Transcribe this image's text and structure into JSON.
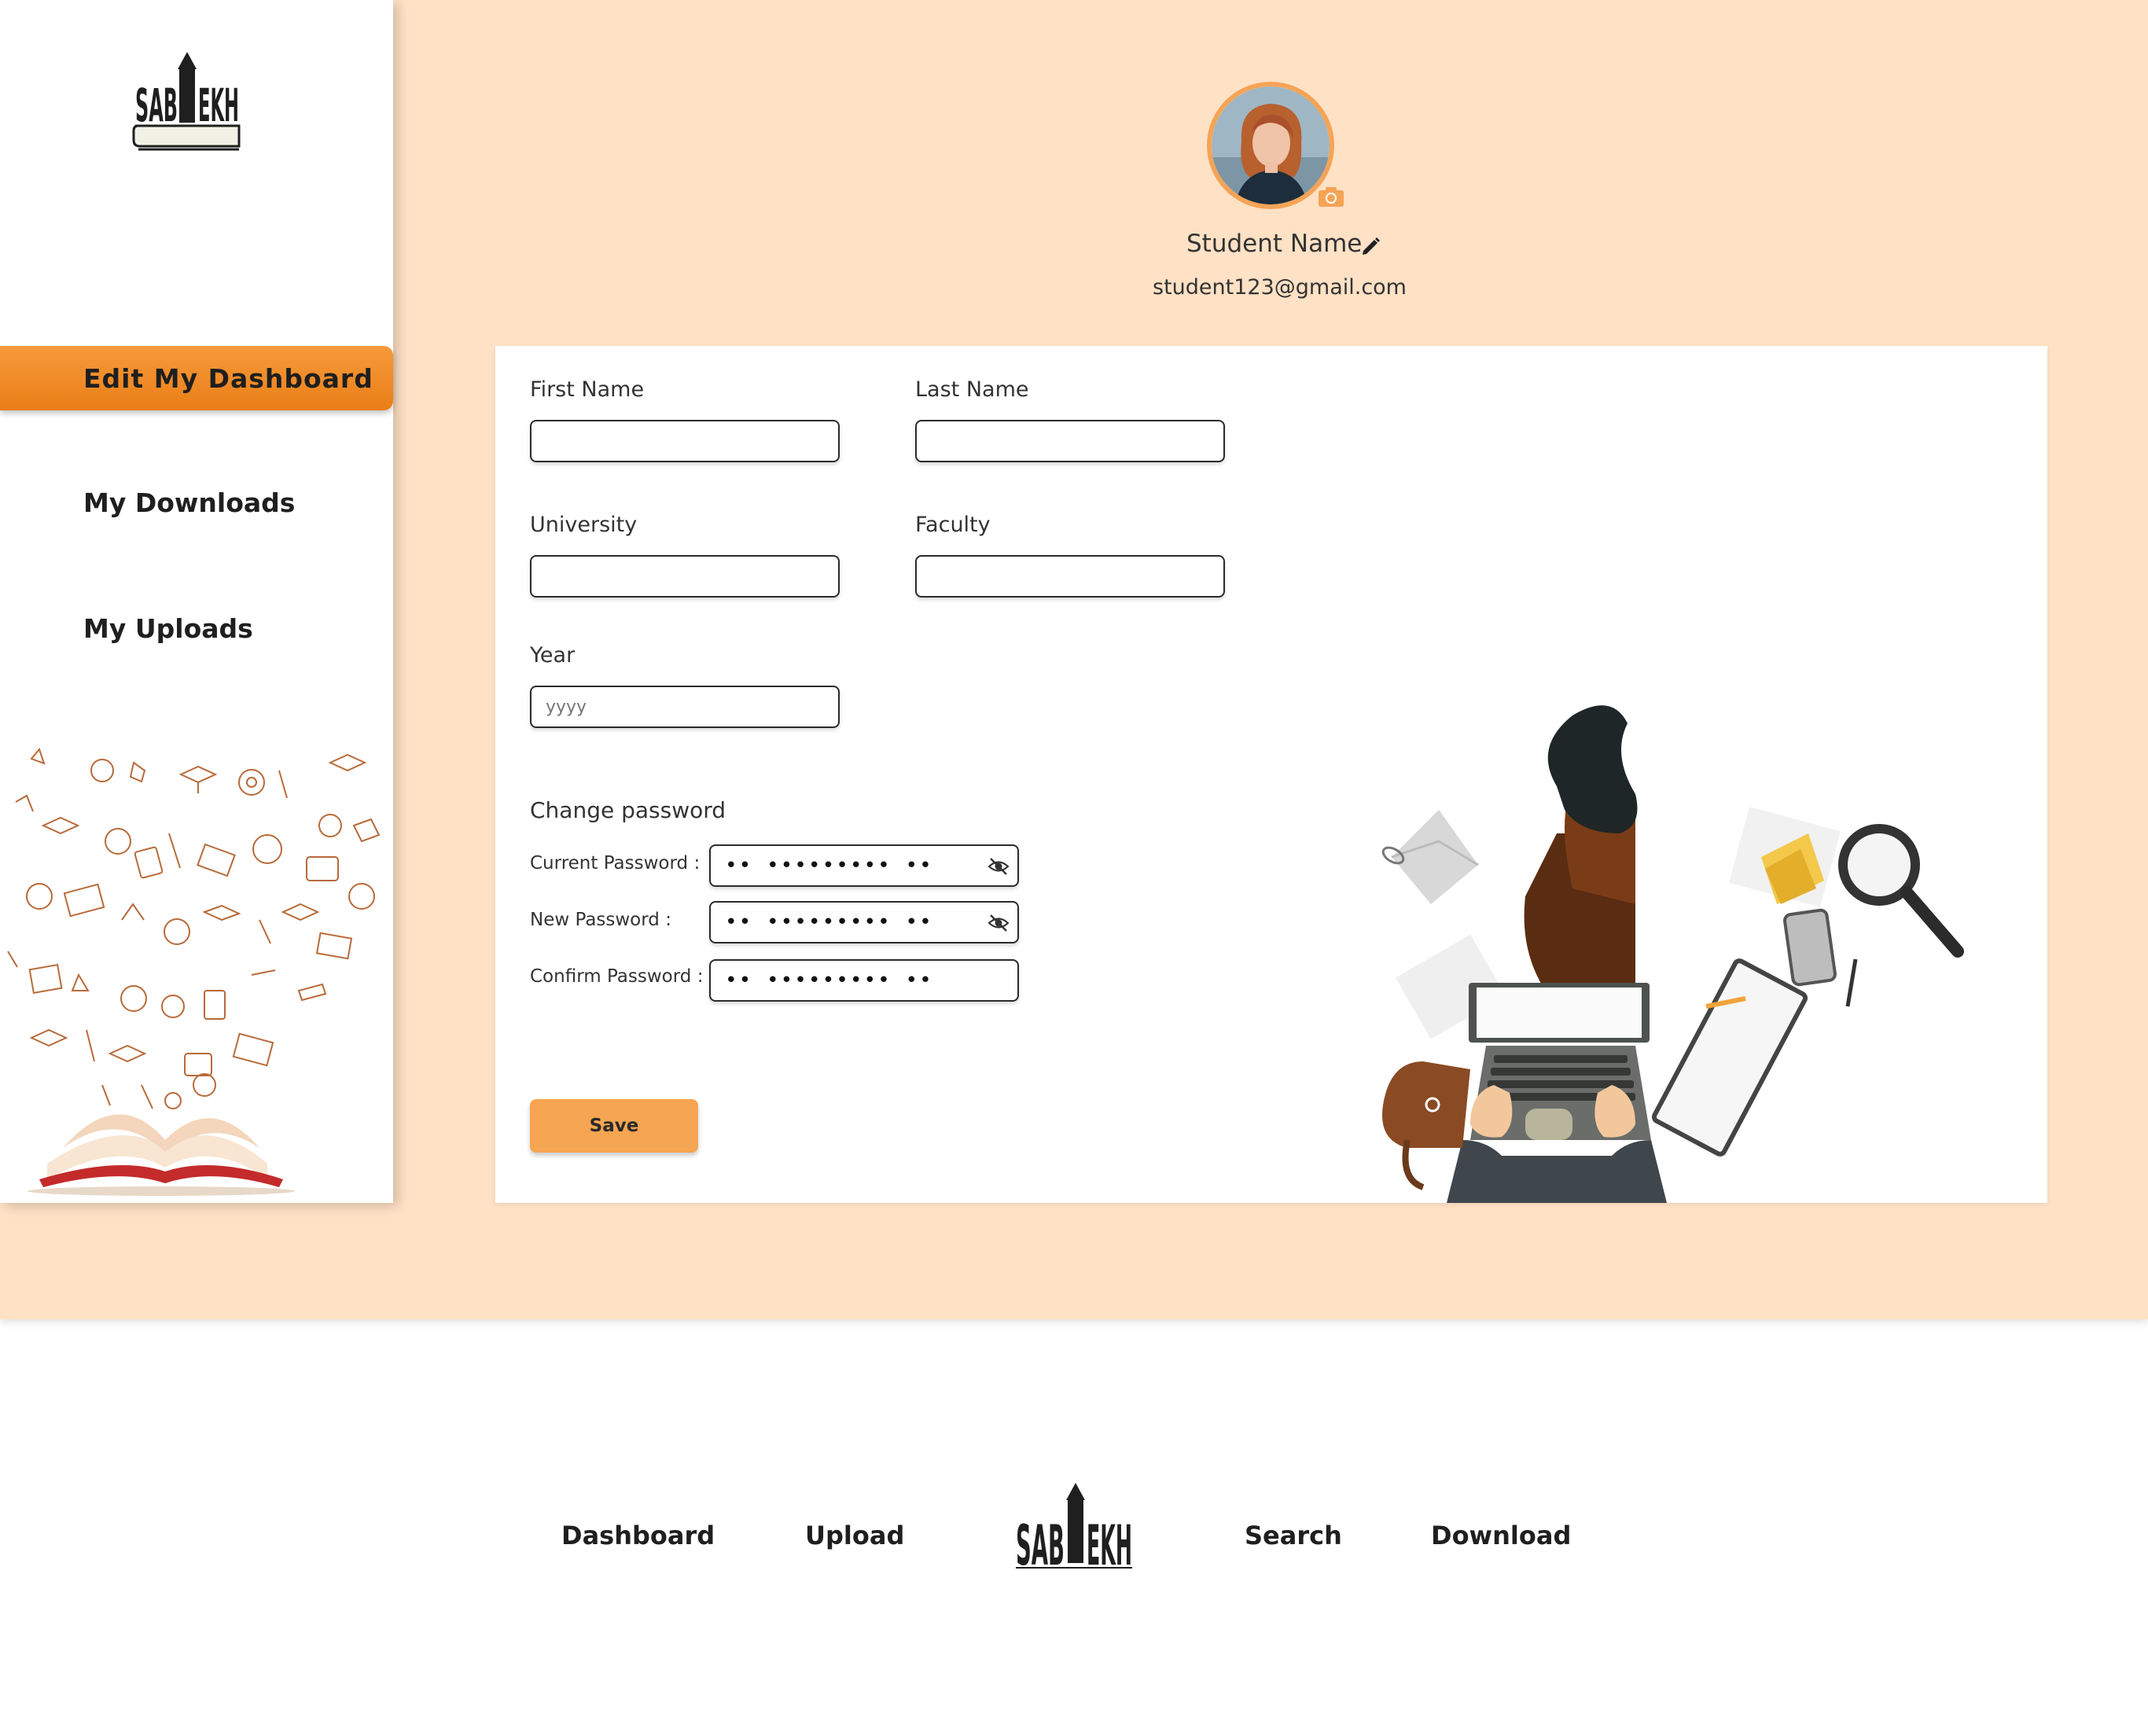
{
  "brand": {
    "logo_text": "SABLEKH",
    "accent": "#f5a455",
    "accent_dark": "#ea7e16",
    "background": "#ffe1c5"
  },
  "sidebar": {
    "items": [
      {
        "label": "Edit My Dashboard",
        "active": true
      },
      {
        "label": "My Downloads",
        "active": false
      },
      {
        "label": "My Uploads",
        "active": false
      }
    ]
  },
  "profile": {
    "name": "Student Name",
    "email": "student123@gmail.com",
    "icons": [
      "camera-icon",
      "pencil-icon"
    ]
  },
  "form": {
    "first_name": {
      "label": "First Name",
      "value": ""
    },
    "last_name": {
      "label": "Last Name",
      "value": ""
    },
    "university": {
      "label": "University",
      "value": ""
    },
    "faculty": {
      "label": "Faculty",
      "value": ""
    },
    "year": {
      "label": "Year",
      "value": "",
      "placeholder": "yyyy"
    },
    "change_password_heading": "Change password",
    "current_password": {
      "label": "Current Password :",
      "masked": "•• ••••••••• ••"
    },
    "new_password": {
      "label": "New Password :",
      "masked": "•• ••••••••• ••"
    },
    "confirm_password": {
      "label": "Confirm Password :",
      "masked": "•• ••••••••• ••"
    },
    "save_label": "Save"
  },
  "footer": {
    "links": [
      "Dashboard",
      "Upload",
      "Search",
      "Download"
    ]
  }
}
